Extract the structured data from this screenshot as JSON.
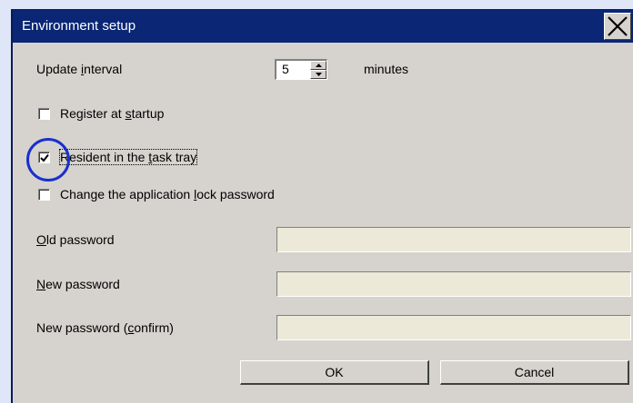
{
  "window": {
    "title": "Environment setup"
  },
  "update_interval": {
    "label_before": "Update ",
    "label_accel": "i",
    "label_after": "nterval",
    "value": "5",
    "unit": "minutes"
  },
  "register_at_startup": {
    "label_before": "Register at ",
    "label_accel": "s",
    "label_after": "tartup",
    "checked": false
  },
  "resident_in_tray": {
    "label_before": "Resident in the ",
    "label_accel": "t",
    "label_after": "ask tray",
    "checked": true
  },
  "change_lock_password": {
    "label_before": "Change the application ",
    "label_accel": "l",
    "label_after": "ock password",
    "checked": false
  },
  "old_password": {
    "label_accel": "O",
    "label_after": "ld password",
    "value": ""
  },
  "new_password": {
    "label_accel": "N",
    "label_after": "ew password",
    "value": ""
  },
  "new_password_confirm": {
    "label_before": "New password (",
    "label_accel": "c",
    "label_after": "onfirm)",
    "value": ""
  },
  "buttons": {
    "ok": "OK",
    "cancel": "Cancel"
  },
  "colors": {
    "titlebar": "#0a2674",
    "dialog_bg": "#d6d3ce",
    "field_bg": "#ece9d8",
    "highlight": "#1a2fcf"
  }
}
